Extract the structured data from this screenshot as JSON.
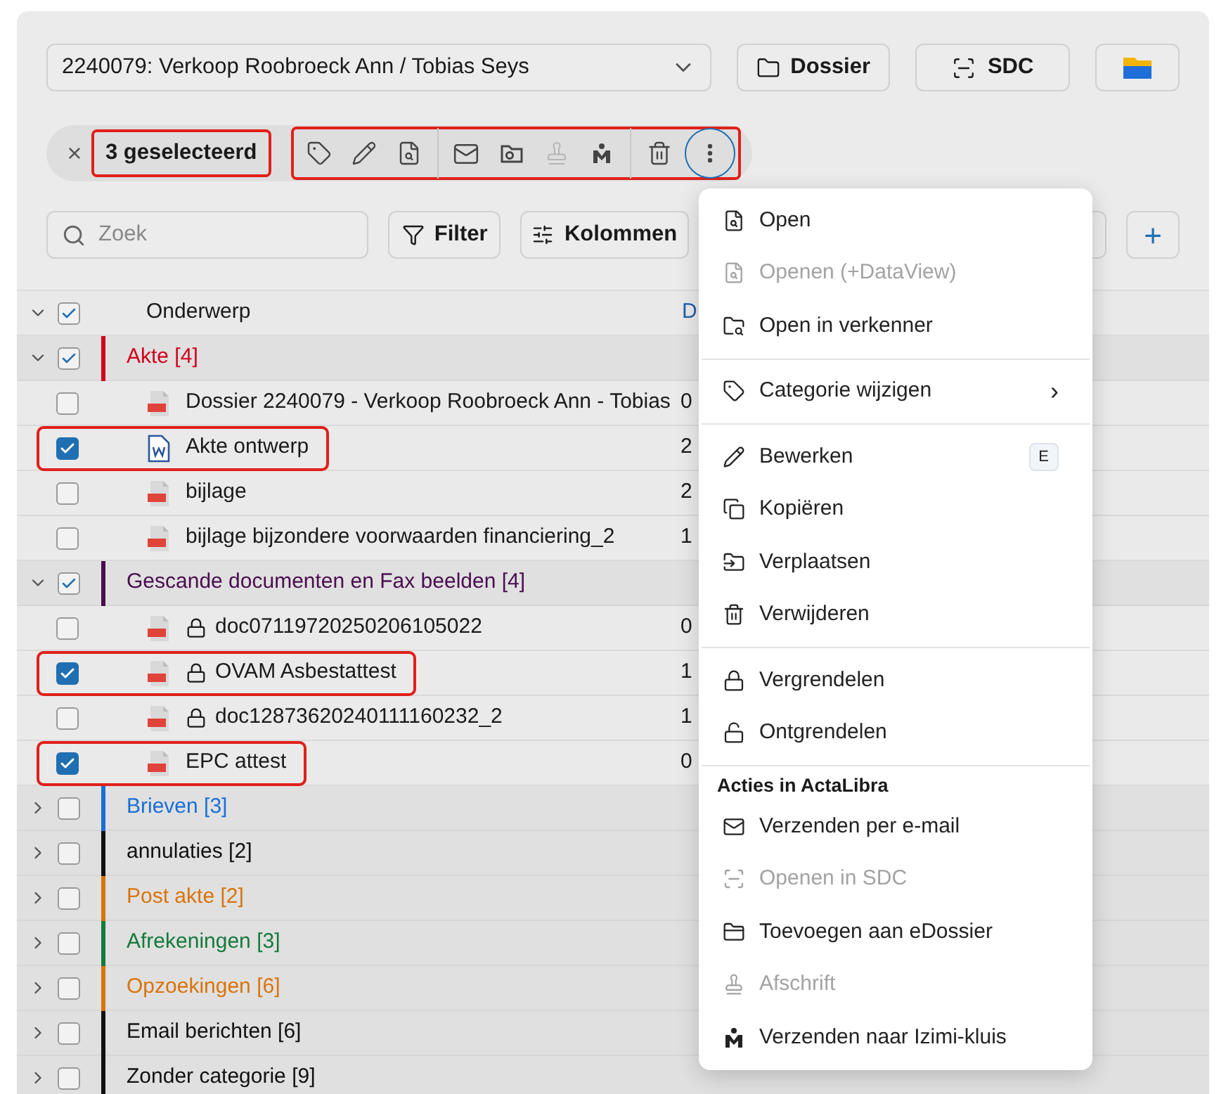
{
  "dossier_select": {
    "value": "2240079: Verkoop Roobroeck Ann / Tobias Seys"
  },
  "header_buttons": [
    {
      "label": "Dossier"
    },
    {
      "label": "SDC"
    }
  ],
  "selection_bar": {
    "clear": "×",
    "count_label": "3 geselecteerd",
    "highlighted": true,
    "toolbar": {
      "highlighted": true,
      "buttons": [
        {
          "disabled": false
        },
        {
          "disabled": false
        },
        {
          "disabled": false
        },
        {
          "disabled": false
        },
        {
          "disabled": false
        },
        {
          "disabled": true
        },
        {
          "disabled": false
        },
        {
          "disabled": false
        }
      ],
      "more": {
        "active": true
      }
    }
  },
  "search": {
    "placeholder": "Zoek"
  },
  "filter_button": "Filter",
  "columns_button": "Kolommen",
  "add_button": "+",
  "table": {
    "header": {
      "expanded": true,
      "checked": true,
      "column_1": "Onderwerp",
      "column_2": "D"
    },
    "groups": [
      {
        "label": "Akte [4]",
        "color": "#d0021b",
        "expanded": true,
        "checked": true,
        "children": [
          {
            "name": "Dossier 2240079 - Verkoop Roobroeck Ann - Tobias",
            "kind": "pdf",
            "locked": false,
            "checked": false,
            "highlighted": false,
            "column_2": "0"
          },
          {
            "name": "Akte ontwerp",
            "kind": "word",
            "locked": false,
            "checked": true,
            "highlighted": true,
            "column_2": "2"
          },
          {
            "name": "bijlage",
            "kind": "pdf",
            "locked": false,
            "checked": false,
            "highlighted": false,
            "column_2": "2"
          },
          {
            "name": "bijlage bijzondere voorwaarden financiering_2",
            "kind": "pdf",
            "locked": false,
            "checked": false,
            "highlighted": false,
            "column_2": "1"
          }
        ]
      },
      {
        "label": "Gescande documenten en Fax beelden [4]",
        "color": "#4a0d4f",
        "expanded": true,
        "checked": true,
        "children": [
          {
            "name": "doc07119720250206105022",
            "kind": "pdf",
            "locked": true,
            "checked": false,
            "highlighted": false,
            "column_2": "0"
          },
          {
            "name": "OVAM Asbestattest",
            "kind": "pdf",
            "locked": true,
            "checked": true,
            "highlighted": true,
            "column_2": "1"
          },
          {
            "name": "doc12873620240111160232_2",
            "kind": "pdf",
            "locked": true,
            "checked": false,
            "highlighted": false,
            "column_2": "1"
          },
          {
            "name": "EPC attest",
            "kind": "pdf",
            "locked": false,
            "checked": true,
            "highlighted": true,
            "column_2": "0"
          }
        ]
      },
      {
        "label": "Brieven [3]",
        "color": "#1a6fd6",
        "expanded": false,
        "checked": false
      },
      {
        "label": "annulaties [2]",
        "color": "#111111",
        "expanded": false,
        "checked": false
      },
      {
        "label": "Post akte [2]",
        "color": "#d9740c",
        "expanded": false,
        "checked": false
      },
      {
        "label": "Afrekeningen [3]",
        "color": "#157a3c",
        "expanded": false,
        "checked": false
      },
      {
        "label": "Opzoekingen [6]",
        "color": "#d9740c",
        "expanded": false,
        "checked": false
      },
      {
        "label": "Email berichten [6]",
        "color": "#111111",
        "expanded": false,
        "checked": false
      },
      {
        "label": "Zonder categorie [9]",
        "color": "#111111",
        "expanded": false,
        "checked": false
      }
    ]
  },
  "context_menu": {
    "entries": [
      {
        "kind": "item",
        "label": "Open",
        "disabled": false
      },
      {
        "kind": "item",
        "label": "Openen (+DataView)",
        "disabled": true
      },
      {
        "kind": "item",
        "label": "Open in verkenner",
        "disabled": false
      },
      {
        "kind": "separator"
      },
      {
        "kind": "item",
        "label": "Categorie wijzigen",
        "disabled": false,
        "submenu": "›"
      },
      {
        "kind": "separator"
      },
      {
        "kind": "item",
        "label": "Bewerken",
        "disabled": false,
        "shortcut": "E"
      },
      {
        "kind": "item",
        "label": "Kopiëren",
        "disabled": false
      },
      {
        "kind": "item",
        "label": "Verplaatsen",
        "disabled": false
      },
      {
        "kind": "item",
        "label": "Verwijderen",
        "disabled": false
      },
      {
        "kind": "separator"
      },
      {
        "kind": "item",
        "label": "Vergrendelen",
        "disabled": false
      },
      {
        "kind": "item",
        "label": "Ontgrendelen",
        "disabled": false
      },
      {
        "kind": "separator"
      },
      {
        "kind": "header",
        "label": "Acties in ActaLibra"
      },
      {
        "kind": "item",
        "label": "Verzenden per e-mail",
        "disabled": false
      },
      {
        "kind": "item",
        "label": "Openen in SDC",
        "disabled": true
      },
      {
        "kind": "item",
        "label": "Toevoegen aan eDossier",
        "disabled": false
      },
      {
        "kind": "item",
        "label": "Afschrift",
        "disabled": true
      },
      {
        "kind": "item",
        "label": "Verzenden naar Izimi-kluis",
        "disabled": false
      }
    ]
  }
}
